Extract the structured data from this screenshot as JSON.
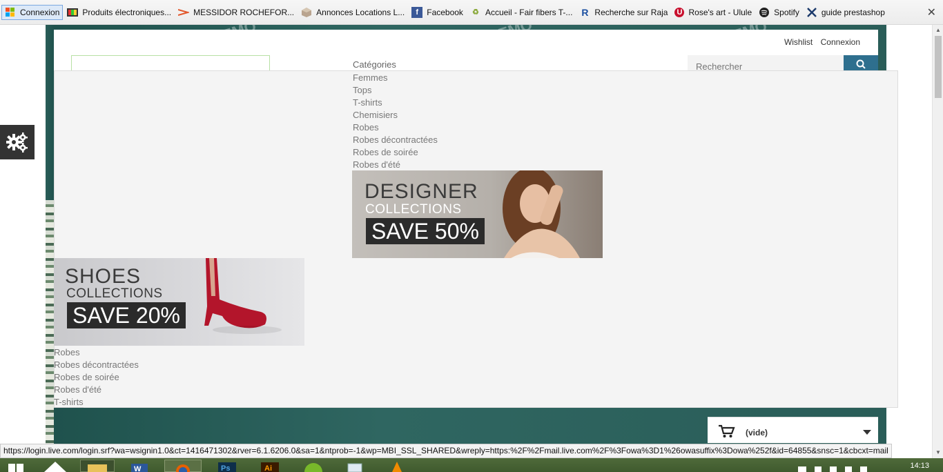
{
  "bookmarks": [
    {
      "label": "Connexion",
      "icon": "windows-icon"
    },
    {
      "label": "Produits électroniques...",
      "icon": "tv-icon"
    },
    {
      "label": "MESSIDOR ROCHEFOR...",
      "icon": "arrow-icon"
    },
    {
      "label": "Annonces Locations L...",
      "icon": "box-icon"
    },
    {
      "label": "Facebook",
      "icon": "facebook-icon"
    },
    {
      "label": "Accueil - Fair fibers T-...",
      "icon": "recycle-icon"
    },
    {
      "label": "Recherche sur Raja",
      "icon": "raja-icon"
    },
    {
      "label": "Rose's art - Ulule",
      "icon": "ulule-icon"
    },
    {
      "label": "Spotify",
      "icon": "spotify-icon"
    },
    {
      "label": "guide prestashop",
      "icon": "prestashop-icon"
    }
  ],
  "header": {
    "wishlist": "Wishlist",
    "login": "Connexion",
    "search_placeholder": "Rechercher"
  },
  "menu": {
    "heading": "Catégories",
    "items": [
      "Femmes",
      "Tops",
      "T-shirts",
      "Chemisiers",
      "Robes",
      "Robes décontractées",
      "Robes de soirée",
      "Robes d'été"
    ],
    "bottom_items": [
      "Robes",
      "Robes décontractées",
      "Robes de soirée",
      "Robes d'été",
      "T-shirts"
    ]
  },
  "banners": {
    "designer": {
      "title": "DESIGNER",
      "subtitle": "COLLECTIONS",
      "save": "SAVE 50%"
    },
    "shoes": {
      "title": "SHOES",
      "subtitle": "COLLECTIONS",
      "save": "SAVE 20%"
    }
  },
  "cart": {
    "label": "(vide)"
  },
  "status_url": "https://login.live.com/login.srf?wa=wsignin1.0&ct=1416471302&rver=6.1.6206.0&sa=1&ntprob=-1&wp=MBI_SSL_SHARED&wreply=https:%2F%2Fmail.live.com%2F%3Fowa%3D1%26owasuffix%3Dowa%252f&id=64855&snsc=1&cbcxt=mail",
  "clock": "14:13",
  "colors": {
    "accent": "#2e6f8e",
    "backdrop": "#2a5d58",
    "panel": "#f4f4f4"
  }
}
